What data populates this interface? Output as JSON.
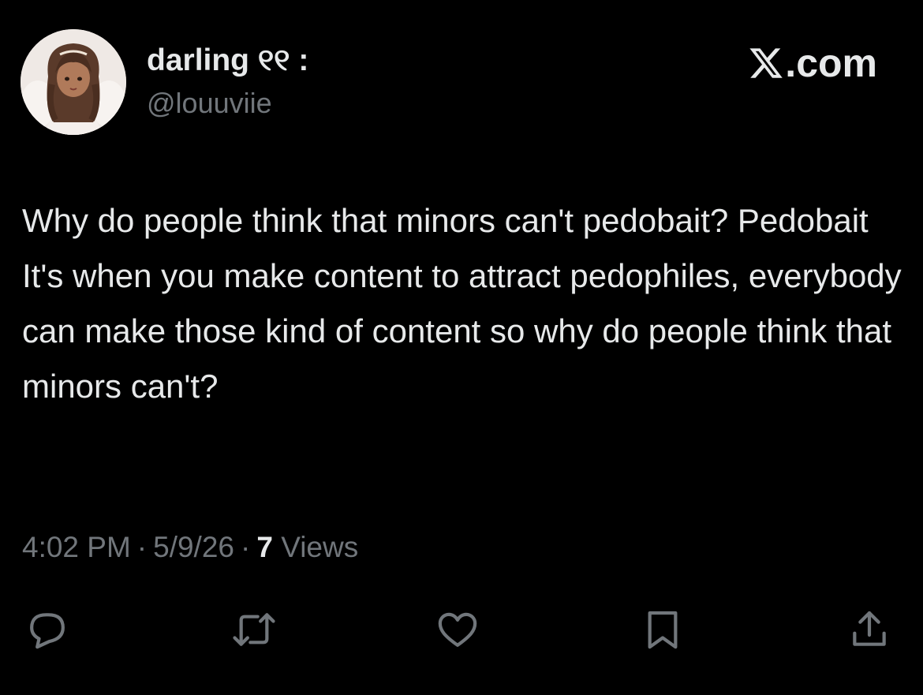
{
  "author": {
    "display_name": "darling ୧୧ :",
    "handle": "@louuviie"
  },
  "brand": {
    "text": ".com",
    "logo_icon": "x-logo-icon"
  },
  "tweet": {
    "text": "Why do people think that minors can't pedobait? Pedobait It's when you make content to attract pedophiles, everybody can make those kind of content so why do people think that minors can't?"
  },
  "meta": {
    "time": "4:02 PM",
    "separator": "·",
    "date": "5/9/26",
    "views_count": "7",
    "views_label": "Views"
  },
  "actions": [
    {
      "name": "reply",
      "icon": "reply-icon"
    },
    {
      "name": "retweet",
      "icon": "retweet-icon"
    },
    {
      "name": "like",
      "icon": "heart-icon"
    },
    {
      "name": "bookmark",
      "icon": "bookmark-icon"
    },
    {
      "name": "share",
      "icon": "share-icon"
    }
  ],
  "colors": {
    "background": "#000000",
    "text_primary": "#e7e9ea",
    "text_secondary": "#71767b"
  }
}
